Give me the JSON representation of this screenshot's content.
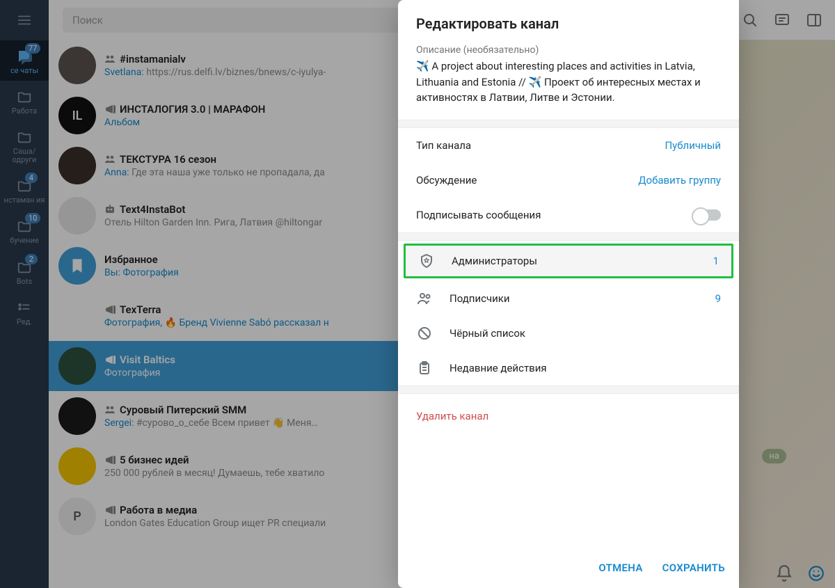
{
  "search": {
    "placeholder": "Поиск"
  },
  "rail": {
    "items": [
      {
        "label": "се чаты",
        "badge": "77",
        "active": true,
        "kind": "chats"
      },
      {
        "label": "Работа",
        "badge": "",
        "kind": "folder"
      },
      {
        "label": "Саша/ одруги",
        "badge": "",
        "kind": "folder"
      },
      {
        "label": "нстаман ия",
        "badge": "4",
        "kind": "folder"
      },
      {
        "label": "бучение",
        "badge": "10",
        "kind": "folder"
      },
      {
        "label": "Bots",
        "badge": "2",
        "kind": "folder"
      },
      {
        "label": "Ред.",
        "badge": "",
        "kind": "edit"
      }
    ]
  },
  "chats": [
    {
      "type": "group",
      "title": "#instamanialv",
      "sender": "Svetlana",
      "subtitle": "https://rus.delfi.lv/biznes/bnews/c-iyulya-",
      "avatarBg": "#5b5351",
      "avatarText": ""
    },
    {
      "type": "channel",
      "title": "ИНСТАЛОГИЯ 3.0 | МАРАФОН",
      "sender": "",
      "subtitle": "Альбом",
      "subtitleLink": true,
      "avatarBg": "#111",
      "avatarText": "IL"
    },
    {
      "type": "group",
      "title": "ТЕКСТУРА 16 сезон",
      "sender": "Anna",
      "subtitle": "Где эта наша уже только не пропадала, да",
      "avatarBg": "#3b2f2a",
      "avatarText": ""
    },
    {
      "type": "bot",
      "title": "Text4InstaBot",
      "sender": "",
      "subtitle": "Отель Hilton Garden Inn. Рига, Латвия @hiltongar",
      "avatarBg": "#e7e7e7",
      "avatarText": ""
    },
    {
      "type": "saved",
      "title": "Избранное",
      "sender": "Вы",
      "subtitle": "Фотография",
      "subtitleLink": true,
      "avatarBg": "#419fd9",
      "avatarText": ""
    },
    {
      "type": "channel",
      "title": "TexTerra",
      "sender": "",
      "subtitle": "Фотография, 🔥 Бренд Vivienne Sabó рассказал н",
      "subtitleLink": true,
      "avatarBg": "#fff",
      "avatarText": ""
    },
    {
      "type": "channel",
      "title": "Visit Baltics",
      "sender": "",
      "subtitle": "Фотография",
      "selected": true,
      "avatarBg": "#2d5240",
      "avatarText": ""
    },
    {
      "type": "group",
      "title": "Суровый Питерский SMM",
      "sender": "Sergei",
      "subtitle": "#сурово_о_себе  Всем привет 👋  Меня…",
      "avatarBg": "#1b1b1b",
      "avatarText": ""
    },
    {
      "type": "channel",
      "title": "5 бизнес идей",
      "sender": "",
      "subtitle": "250 000 рублей в месяц!  Думаешь, тебе хватило",
      "avatarBg": "#f6c500",
      "avatarText": ""
    },
    {
      "type": "channel",
      "title": "Работа в медиа",
      "sender": "",
      "subtitle": "London Gates Education Group ищет PR специали",
      "avatarBg": "#eeeeee",
      "avatarText": "Р"
    }
  ],
  "modal": {
    "title": "Редактировать канал",
    "descLabel": "Описание (необязательно)",
    "descText": "✈️  A project about interesting places and activities in Latvia, Lithuania and Estonia // ✈️ Проект об интересных местах и активностях в Латвии, Литве и Эстонии.",
    "channelType": {
      "label": "Тип канала",
      "value": "Публичный"
    },
    "discussion": {
      "label": "Обсуждение",
      "value": "Добавить группу"
    },
    "signMessages": {
      "label": "Подписывать сообщения"
    },
    "rows": {
      "admins": {
        "label": "Администраторы",
        "count": "1"
      },
      "subscribers": {
        "label": "Подписчики",
        "count": "9"
      },
      "blacklist": {
        "label": "Чёрный список"
      },
      "recent": {
        "label": "Недавние действия"
      }
    },
    "delete": "Удалить канал",
    "cancel": "ОТМЕНА",
    "save": "СОХРАНИТЬ"
  },
  "bgChip": "на"
}
